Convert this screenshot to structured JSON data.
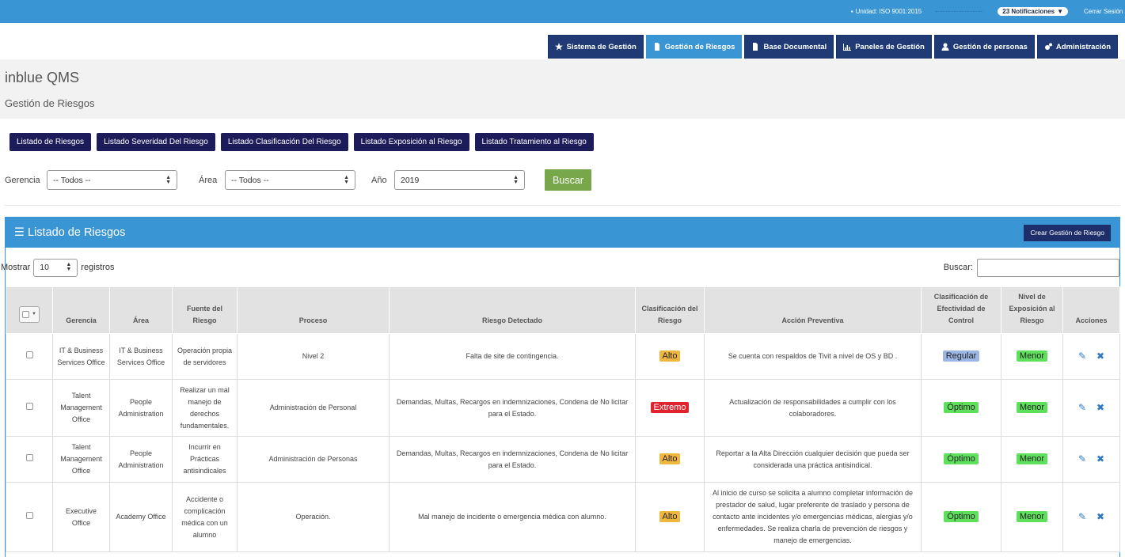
{
  "topbar": {
    "unit": "Unidad: ISO 9001:2015",
    "notifications": "23 Notificaciones",
    "logout": "Cerrar Sesión"
  },
  "nav": [
    {
      "label": "Sistema de Gestión",
      "icon": "star-icon"
    },
    {
      "label": "Gestión de Riesgos",
      "icon": "document-icon",
      "active": true
    },
    {
      "label": "Base Documental",
      "icon": "document-icon"
    },
    {
      "label": "Paneles de Gestión",
      "icon": "chart-icon"
    },
    {
      "label": "Gestión de personas",
      "icon": "user-icon"
    },
    {
      "label": "Administración",
      "icon": "gears-icon"
    }
  ],
  "header": {
    "app": "inblue QMS",
    "section": "Gestión de Riesgos"
  },
  "tabs": [
    "Listado de Riesgos",
    "Listado Severidad Del Riesgo",
    "Listado Clasificación Del Riesgo",
    "Listado Exposición al Riesgo",
    "Listado Tratamiento al Riesgo"
  ],
  "filters": {
    "gerencia_label": "Gerencia",
    "gerencia_value": "-- Todos --",
    "area_label": "Área",
    "area_value": "-- Todos --",
    "anio_label": "Año",
    "anio_value": "2019",
    "buscar": "Buscar"
  },
  "panel": {
    "title": "Listado de Riesgos",
    "create": "Crear Gestión de Riesgo",
    "show_prefix": "Mostrar",
    "show_value": "10",
    "show_suffix": "registros",
    "search_label": "Buscar:"
  },
  "columns": [
    "Gerencia",
    "Área",
    "Fuente del Riesgo",
    "Proceso",
    "Riesgo Detectado",
    "Clasificación del Riesgo",
    "Acción Preventiva",
    "Clasificación de Efectividad de Control",
    "Nivel de Exposición al Riesgo",
    "Acciones"
  ],
  "rows": [
    {
      "gerencia": "IT & Business Services Office",
      "area": "IT & Business Services Office",
      "fuente": "Operación propia de servidores",
      "proceso": "Nivel 2",
      "riesgo": "Falta de site de contingencia.",
      "clasif": "Alto",
      "accion": "Se cuenta con respaldos de Tivit a nivel de OS y BD .",
      "efect": "Regular",
      "nivel": "Menor"
    },
    {
      "gerencia": "Talent Management Office",
      "area": "People Administration",
      "fuente": "Realizar un mal manejo de derechos fundamentales.",
      "proceso": "Administración de Personal",
      "riesgo": "Demandas, Multas, Recargos en indemnizaciones, Condena de No licitar para el Estado.",
      "clasif": "Extremo",
      "accion": "Actualización de responsabilidades a cumplir con los colaboradores.",
      "efect": "Óptimo",
      "nivel": "Menor"
    },
    {
      "gerencia": "Talent Management Office",
      "area": "People Administration",
      "fuente": "Incurrir en Prácticas antisindicales",
      "proceso": "Administración de Personas",
      "riesgo": "Demandas, Multas, Recargos en indemnizaciones, Condena de No licitar para el Estado.",
      "clasif": "Alto",
      "accion": "Reportar a la Alta Dirección cualquier decisión que pueda ser considerada una práctica antisindical.",
      "efect": "Óptimo",
      "nivel": "Menor"
    },
    {
      "gerencia": "Executive Office",
      "area": "Academy Office",
      "fuente": "Accidente o complicación médica con un alumno",
      "proceso": "Operación.",
      "riesgo": "Mal manejo de incidente o emergencia médica con alumno.",
      "clasif": "Alto",
      "accion": "Al inicio de curso se solicita a alumno completar información de prestador de salud, lugar preferente de traslado y persona de contacto ante incidentes y/o emergencias médicas, alergias y/o enfermedades. Se realiza charla de prevención de riesgos y manejo de emergencias.",
      "efect": "Óptimo",
      "nivel": "Menor"
    }
  ]
}
